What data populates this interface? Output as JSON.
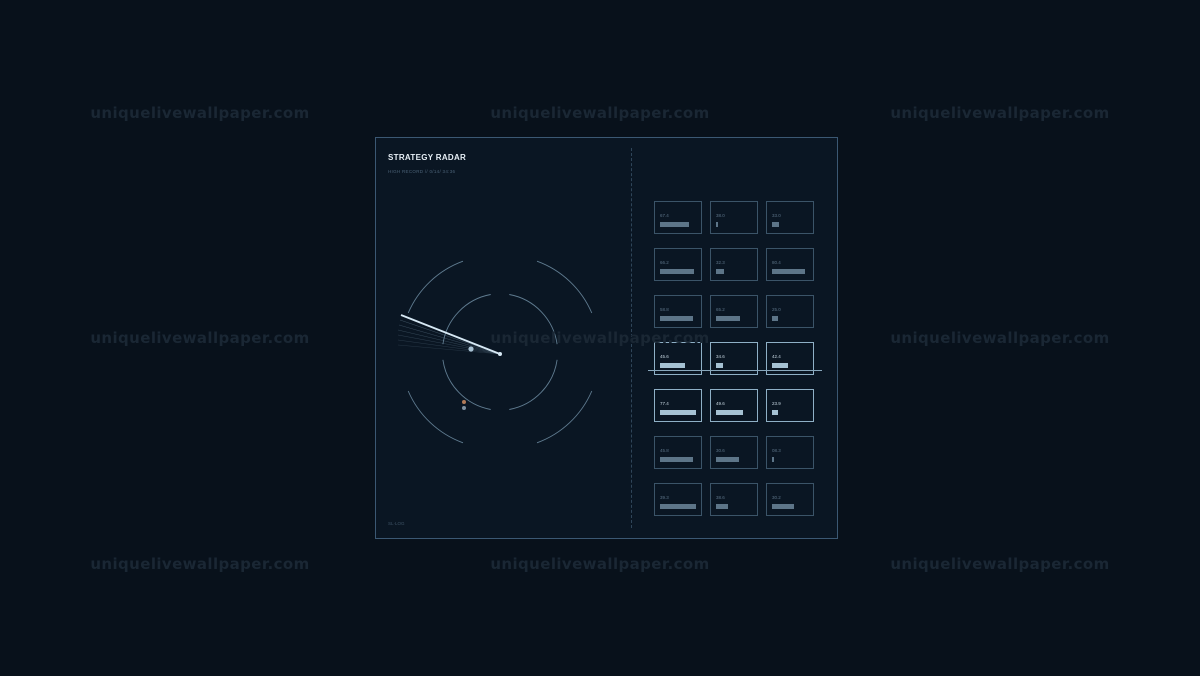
{
  "watermark": "uniquelivewallpaper.com",
  "panel": {
    "title": "STRATEGY RADAR",
    "subtitle": "HIGH RECORD // 0/14/ 34:36",
    "footer": "SL·LOG"
  },
  "colors": {
    "background": "#08111b",
    "panel": "#0a1623",
    "border": "#3b5873",
    "sweep": "#d6e8f4",
    "marker_orange": "#b07a58",
    "tile_border": "#3b5468",
    "tile_active_border": "#8fb0c6"
  },
  "tiles": [
    [
      {
        "value": "67.4",
        "bar": 0.76,
        "active": false
      },
      {
        "value": "38.0",
        "bar": 0.05,
        "active": false
      },
      {
        "value": "33.0",
        "bar": 0.18,
        "active": false
      }
    ],
    [
      {
        "value": "66.2",
        "bar": 0.9,
        "active": false
      },
      {
        "value": "32.3",
        "bar": 0.22,
        "active": false
      },
      {
        "value": "80.4",
        "bar": 0.87,
        "active": false
      }
    ],
    [
      {
        "value": "58.8",
        "bar": 0.87,
        "active": false
      },
      {
        "value": "65.2",
        "bar": 0.63,
        "active": false
      },
      {
        "value": "25.0",
        "bar": 0.16,
        "active": false
      }
    ],
    [
      {
        "value": "45.6",
        "bar": 0.66,
        "active": true
      },
      {
        "value": "34.6",
        "bar": 0.18,
        "active": true
      },
      {
        "value": "42.4",
        "bar": 0.42,
        "active": true
      }
    ],
    [
      {
        "value": "77.4",
        "bar": 0.95,
        "active": true
      },
      {
        "value": "49.6",
        "bar": 0.71,
        "active": true
      },
      {
        "value": "23.9",
        "bar": 0.16,
        "active": true
      }
    ],
    [
      {
        "value": "45.8",
        "bar": 0.87,
        "active": false
      },
      {
        "value": "30.6",
        "bar": 0.61,
        "active": false
      },
      {
        "value": "08.3",
        "bar": 0.05,
        "active": false
      }
    ],
    [
      {
        "value": "39.3",
        "bar": 0.95,
        "active": false
      },
      {
        "value": "38.6",
        "bar": 0.32,
        "active": false
      },
      {
        "value": "30.2",
        "bar": 0.58,
        "active": false
      }
    ]
  ]
}
